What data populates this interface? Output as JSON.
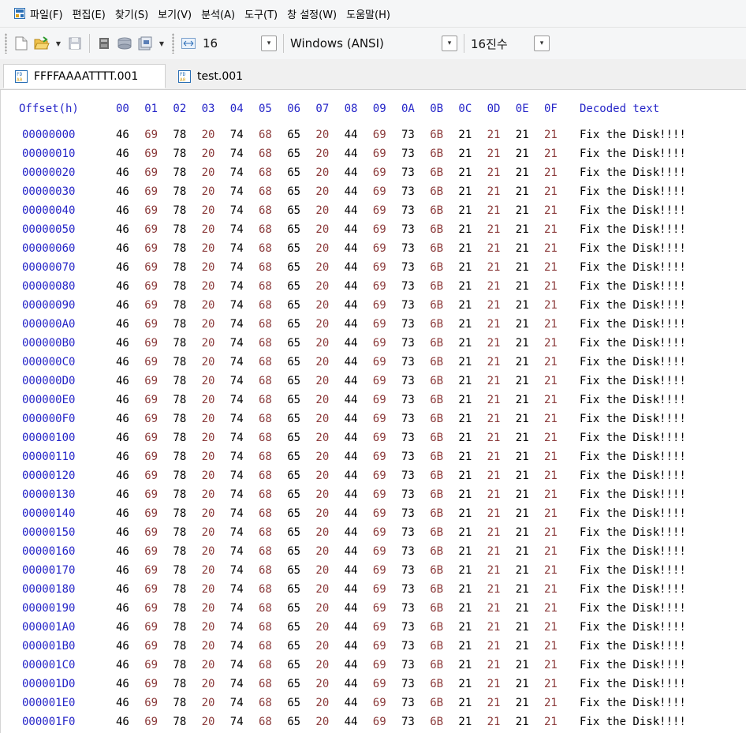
{
  "menu": [
    "파일(F)",
    "편집(E)",
    "찾기(S)",
    "보기(V)",
    "분석(A)",
    "도구(T)",
    "창 설정(W)",
    "도움말(H)"
  ],
  "toolbar": {
    "bytes_per_row": "16",
    "encoding": "Windows (ANSI)",
    "display_mode": "16진수"
  },
  "tabs": [
    {
      "label": "FFFFAAAATTTT.001",
      "active": true
    },
    {
      "label": "test.001",
      "active": false
    }
  ],
  "hex_view": {
    "offset_header": "Offset(h)",
    "columns": [
      "00",
      "01",
      "02",
      "03",
      "04",
      "05",
      "06",
      "07",
      "08",
      "09",
      "0A",
      "0B",
      "0C",
      "0D",
      "0E",
      "0F"
    ],
    "decoded_header": "Decoded text",
    "rows": [
      {
        "offset": "00000000",
        "bytes": [
          "46",
          "69",
          "78",
          "20",
          "74",
          "68",
          "65",
          "20",
          "44",
          "69",
          "73",
          "6B",
          "21",
          "21",
          "21",
          "21"
        ],
        "text": "Fix the Disk!!!!"
      },
      {
        "offset": "00000010",
        "bytes": [
          "46",
          "69",
          "78",
          "20",
          "74",
          "68",
          "65",
          "20",
          "44",
          "69",
          "73",
          "6B",
          "21",
          "21",
          "21",
          "21"
        ],
        "text": "Fix the Disk!!!!"
      },
      {
        "offset": "00000020",
        "bytes": [
          "46",
          "69",
          "78",
          "20",
          "74",
          "68",
          "65",
          "20",
          "44",
          "69",
          "73",
          "6B",
          "21",
          "21",
          "21",
          "21"
        ],
        "text": "Fix the Disk!!!!"
      },
      {
        "offset": "00000030",
        "bytes": [
          "46",
          "69",
          "78",
          "20",
          "74",
          "68",
          "65",
          "20",
          "44",
          "69",
          "73",
          "6B",
          "21",
          "21",
          "21",
          "21"
        ],
        "text": "Fix the Disk!!!!"
      },
      {
        "offset": "00000040",
        "bytes": [
          "46",
          "69",
          "78",
          "20",
          "74",
          "68",
          "65",
          "20",
          "44",
          "69",
          "73",
          "6B",
          "21",
          "21",
          "21",
          "21"
        ],
        "text": "Fix the Disk!!!!"
      },
      {
        "offset": "00000050",
        "bytes": [
          "46",
          "69",
          "78",
          "20",
          "74",
          "68",
          "65",
          "20",
          "44",
          "69",
          "73",
          "6B",
          "21",
          "21",
          "21",
          "21"
        ],
        "text": "Fix the Disk!!!!"
      },
      {
        "offset": "00000060",
        "bytes": [
          "46",
          "69",
          "78",
          "20",
          "74",
          "68",
          "65",
          "20",
          "44",
          "69",
          "73",
          "6B",
          "21",
          "21",
          "21",
          "21"
        ],
        "text": "Fix the Disk!!!!"
      },
      {
        "offset": "00000070",
        "bytes": [
          "46",
          "69",
          "78",
          "20",
          "74",
          "68",
          "65",
          "20",
          "44",
          "69",
          "73",
          "6B",
          "21",
          "21",
          "21",
          "21"
        ],
        "text": "Fix the Disk!!!!"
      },
      {
        "offset": "00000080",
        "bytes": [
          "46",
          "69",
          "78",
          "20",
          "74",
          "68",
          "65",
          "20",
          "44",
          "69",
          "73",
          "6B",
          "21",
          "21",
          "21",
          "21"
        ],
        "text": "Fix the Disk!!!!"
      },
      {
        "offset": "00000090",
        "bytes": [
          "46",
          "69",
          "78",
          "20",
          "74",
          "68",
          "65",
          "20",
          "44",
          "69",
          "73",
          "6B",
          "21",
          "21",
          "21",
          "21"
        ],
        "text": "Fix the Disk!!!!"
      },
      {
        "offset": "000000A0",
        "bytes": [
          "46",
          "69",
          "78",
          "20",
          "74",
          "68",
          "65",
          "20",
          "44",
          "69",
          "73",
          "6B",
          "21",
          "21",
          "21",
          "21"
        ],
        "text": "Fix the Disk!!!!"
      },
      {
        "offset": "000000B0",
        "bytes": [
          "46",
          "69",
          "78",
          "20",
          "74",
          "68",
          "65",
          "20",
          "44",
          "69",
          "73",
          "6B",
          "21",
          "21",
          "21",
          "21"
        ],
        "text": "Fix the Disk!!!!"
      },
      {
        "offset": "000000C0",
        "bytes": [
          "46",
          "69",
          "78",
          "20",
          "74",
          "68",
          "65",
          "20",
          "44",
          "69",
          "73",
          "6B",
          "21",
          "21",
          "21",
          "21"
        ],
        "text": "Fix the Disk!!!!"
      },
      {
        "offset": "000000D0",
        "bytes": [
          "46",
          "69",
          "78",
          "20",
          "74",
          "68",
          "65",
          "20",
          "44",
          "69",
          "73",
          "6B",
          "21",
          "21",
          "21",
          "21"
        ],
        "text": "Fix the Disk!!!!"
      },
      {
        "offset": "000000E0",
        "bytes": [
          "46",
          "69",
          "78",
          "20",
          "74",
          "68",
          "65",
          "20",
          "44",
          "69",
          "73",
          "6B",
          "21",
          "21",
          "21",
          "21"
        ],
        "text": "Fix the Disk!!!!"
      },
      {
        "offset": "000000F0",
        "bytes": [
          "46",
          "69",
          "78",
          "20",
          "74",
          "68",
          "65",
          "20",
          "44",
          "69",
          "73",
          "6B",
          "21",
          "21",
          "21",
          "21"
        ],
        "text": "Fix the Disk!!!!"
      },
      {
        "offset": "00000100",
        "bytes": [
          "46",
          "69",
          "78",
          "20",
          "74",
          "68",
          "65",
          "20",
          "44",
          "69",
          "73",
          "6B",
          "21",
          "21",
          "21",
          "21"
        ],
        "text": "Fix the Disk!!!!"
      },
      {
        "offset": "00000110",
        "bytes": [
          "46",
          "69",
          "78",
          "20",
          "74",
          "68",
          "65",
          "20",
          "44",
          "69",
          "73",
          "6B",
          "21",
          "21",
          "21",
          "21"
        ],
        "text": "Fix the Disk!!!!"
      },
      {
        "offset": "00000120",
        "bytes": [
          "46",
          "69",
          "78",
          "20",
          "74",
          "68",
          "65",
          "20",
          "44",
          "69",
          "73",
          "6B",
          "21",
          "21",
          "21",
          "21"
        ],
        "text": "Fix the Disk!!!!"
      },
      {
        "offset": "00000130",
        "bytes": [
          "46",
          "69",
          "78",
          "20",
          "74",
          "68",
          "65",
          "20",
          "44",
          "69",
          "73",
          "6B",
          "21",
          "21",
          "21",
          "21"
        ],
        "text": "Fix the Disk!!!!"
      },
      {
        "offset": "00000140",
        "bytes": [
          "46",
          "69",
          "78",
          "20",
          "74",
          "68",
          "65",
          "20",
          "44",
          "69",
          "73",
          "6B",
          "21",
          "21",
          "21",
          "21"
        ],
        "text": "Fix the Disk!!!!"
      },
      {
        "offset": "00000150",
        "bytes": [
          "46",
          "69",
          "78",
          "20",
          "74",
          "68",
          "65",
          "20",
          "44",
          "69",
          "73",
          "6B",
          "21",
          "21",
          "21",
          "21"
        ],
        "text": "Fix the Disk!!!!"
      },
      {
        "offset": "00000160",
        "bytes": [
          "46",
          "69",
          "78",
          "20",
          "74",
          "68",
          "65",
          "20",
          "44",
          "69",
          "73",
          "6B",
          "21",
          "21",
          "21",
          "21"
        ],
        "text": "Fix the Disk!!!!"
      },
      {
        "offset": "00000170",
        "bytes": [
          "46",
          "69",
          "78",
          "20",
          "74",
          "68",
          "65",
          "20",
          "44",
          "69",
          "73",
          "6B",
          "21",
          "21",
          "21",
          "21"
        ],
        "text": "Fix the Disk!!!!"
      },
      {
        "offset": "00000180",
        "bytes": [
          "46",
          "69",
          "78",
          "20",
          "74",
          "68",
          "65",
          "20",
          "44",
          "69",
          "73",
          "6B",
          "21",
          "21",
          "21",
          "21"
        ],
        "text": "Fix the Disk!!!!"
      },
      {
        "offset": "00000190",
        "bytes": [
          "46",
          "69",
          "78",
          "20",
          "74",
          "68",
          "65",
          "20",
          "44",
          "69",
          "73",
          "6B",
          "21",
          "21",
          "21",
          "21"
        ],
        "text": "Fix the Disk!!!!"
      },
      {
        "offset": "000001A0",
        "bytes": [
          "46",
          "69",
          "78",
          "20",
          "74",
          "68",
          "65",
          "20",
          "44",
          "69",
          "73",
          "6B",
          "21",
          "21",
          "21",
          "21"
        ],
        "text": "Fix the Disk!!!!"
      },
      {
        "offset": "000001B0",
        "bytes": [
          "46",
          "69",
          "78",
          "20",
          "74",
          "68",
          "65",
          "20",
          "44",
          "69",
          "73",
          "6B",
          "21",
          "21",
          "21",
          "21"
        ],
        "text": "Fix the Disk!!!!"
      },
      {
        "offset": "000001C0",
        "bytes": [
          "46",
          "69",
          "78",
          "20",
          "74",
          "68",
          "65",
          "20",
          "44",
          "69",
          "73",
          "6B",
          "21",
          "21",
          "21",
          "21"
        ],
        "text": "Fix the Disk!!!!"
      },
      {
        "offset": "000001D0",
        "bytes": [
          "46",
          "69",
          "78",
          "20",
          "74",
          "68",
          "65",
          "20",
          "44",
          "69",
          "73",
          "6B",
          "21",
          "21",
          "21",
          "21"
        ],
        "text": "Fix the Disk!!!!"
      },
      {
        "offset": "000001E0",
        "bytes": [
          "46",
          "69",
          "78",
          "20",
          "74",
          "68",
          "65",
          "20",
          "44",
          "69",
          "73",
          "6B",
          "21",
          "21",
          "21",
          "21"
        ],
        "text": "Fix the Disk!!!!"
      },
      {
        "offset": "000001F0",
        "bytes": [
          "46",
          "69",
          "78",
          "20",
          "74",
          "68",
          "65",
          "20",
          "44",
          "69",
          "73",
          "6B",
          "21",
          "21",
          "21",
          "21"
        ],
        "text": "Fix the Disk!!!!"
      }
    ]
  },
  "colors": {
    "offset_text": "#2525c8",
    "byte_even_column": "#000000",
    "byte_odd_column": "#8b3a3a",
    "chrome_background": "#f5f6f7"
  }
}
